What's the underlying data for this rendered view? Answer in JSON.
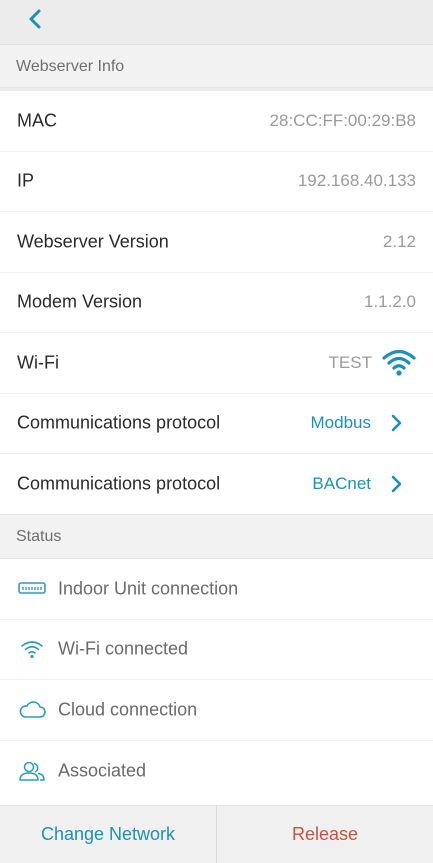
{
  "topbar": {
    "back_icon": "chevron-left-icon"
  },
  "sections": {
    "webserver_title": "Webserver Info",
    "status_title": "Status"
  },
  "info": {
    "mac_label": "MAC",
    "mac_value": "28:CC:FF:00:29:B8",
    "ip_label": "IP",
    "ip_value": "192.168.40.133",
    "webserver_version_label": "Webserver Version",
    "webserver_version_value": "2.12",
    "modem_version_label": "Modem Version",
    "modem_version_value": "1.1.2.0",
    "wifi_label": "Wi-Fi",
    "wifi_value": "TEST",
    "protocol1_label": "Communications protocol",
    "protocol1_value": "Modbus",
    "protocol2_label": "Communications protocol",
    "protocol2_value": "BACnet"
  },
  "status": {
    "items": [
      {
        "label": "Indoor Unit connection",
        "icon": "indoor-unit-icon"
      },
      {
        "label": "Wi-Fi connected",
        "icon": "wifi-icon"
      },
      {
        "label": "Cloud connection",
        "icon": "cloud-icon"
      },
      {
        "label": "Associated",
        "icon": "users-icon"
      }
    ]
  },
  "bottom": {
    "change_network": "Change Network",
    "release": "Release"
  },
  "colors": {
    "accent": "#1b91b6",
    "danger": "#c4553a",
    "icon_gray": "#2b9cc1"
  }
}
